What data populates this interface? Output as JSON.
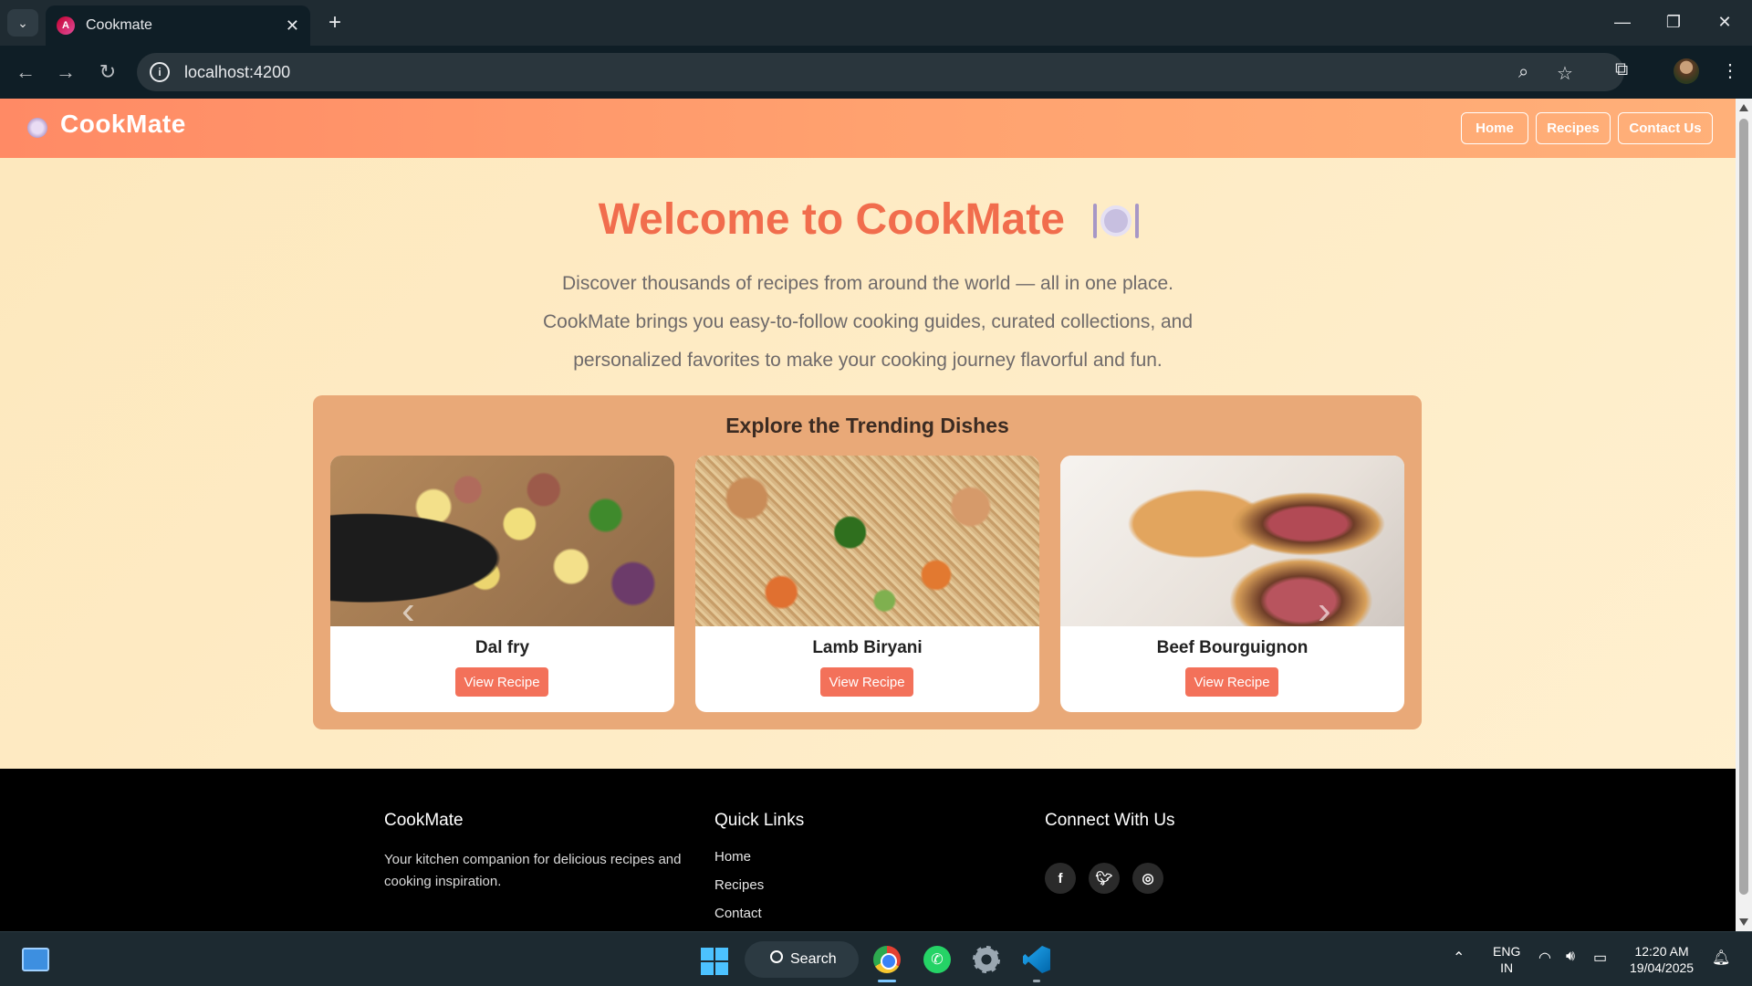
{
  "browser": {
    "tab_title": "Cookmate",
    "url": "localhost:4200"
  },
  "site": {
    "brand": "CookMate",
    "nav": [
      "Home",
      "Recipes",
      "Contact Us"
    ],
    "hero": {
      "title": "Welcome to CookMate",
      "text": "Discover thousands of recipes from around the world — all in one place. CookMate brings you easy-to-follow cooking guides, curated collections, and personalized favorites to make your cooking journey flavorful and fun."
    },
    "trending": {
      "title": "Explore the Trending Dishes",
      "cards": [
        {
          "name": "Dal fry",
          "button": "View Recipe"
        },
        {
          "name": "Lamb Biryani",
          "button": "View Recipe"
        },
        {
          "name": "Beef Bourguignon",
          "button": "View Recipe"
        }
      ]
    },
    "footer": {
      "brand_heading": "CookMate",
      "brand_text": "Your kitchen companion for delicious recipes and cooking inspiration.",
      "links_heading": "Quick Links",
      "links": [
        "Home",
        "Recipes",
        "Contact"
      ],
      "social_heading": "Connect With Us",
      "social_icons": [
        "facebook-icon",
        "twitter-icon",
        "instagram-icon"
      ]
    },
    "colors": {
      "accent": "#f16d4d",
      "header_gradient_start": "#ff8a65",
      "trend_panel": "#e9a978",
      "button": "#f3715a"
    }
  },
  "taskbar": {
    "search_label": "Search",
    "lang_line1": "ENG",
    "lang_line2": "IN",
    "time": "12:20 AM",
    "date": "19/04/2025"
  }
}
